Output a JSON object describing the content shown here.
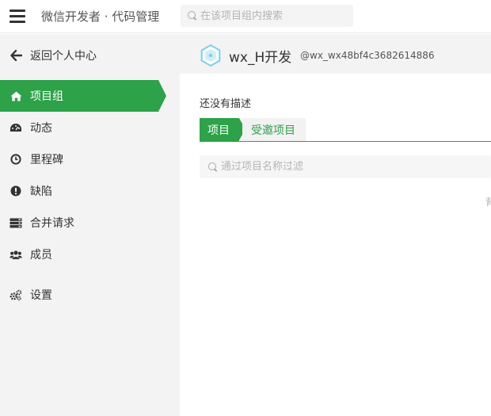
{
  "header": {
    "app_title": "微信开发者 · 代码管理",
    "search_placeholder": "在该项目组内搜索"
  },
  "sidebar": {
    "back_label": "返回个人中心",
    "items": [
      {
        "label": "项目组",
        "icon": "home-icon",
        "active": true
      },
      {
        "label": "动态",
        "icon": "dashboard-icon",
        "active": false
      },
      {
        "label": "里程碑",
        "icon": "clock-icon",
        "active": false
      },
      {
        "label": "缺陷",
        "icon": "exclamation-icon",
        "active": false
      },
      {
        "label": "合并请求",
        "icon": "server-icon",
        "active": false
      },
      {
        "label": "成员",
        "icon": "users-icon",
        "active": false
      },
      {
        "label": "设置",
        "icon": "gears-icon",
        "active": false
      }
    ]
  },
  "group": {
    "name": "wx_H开发",
    "path": "@wx_wx48bf4c3682614886",
    "description": "还没有描述"
  },
  "tabs": [
    {
      "label": "项目",
      "active": true
    },
    {
      "label": "受邀项目",
      "active": false
    }
  ],
  "filter": {
    "placeholder": "通过项目名称过滤"
  },
  "clipped_text": "背",
  "colors": {
    "accent": "#2da248",
    "sidebar_bg": "#f3f3f3"
  }
}
